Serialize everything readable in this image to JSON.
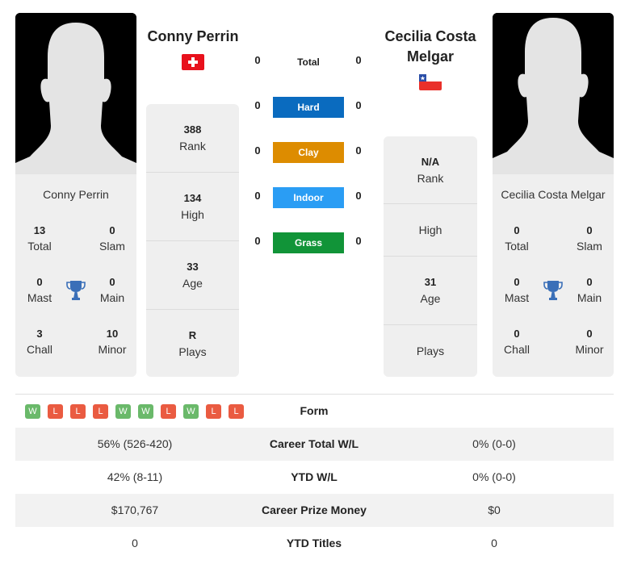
{
  "player1": {
    "name": "Conny Perrin",
    "flag": "switzerland-flag",
    "card_name": "Conny Perrin",
    "titles": {
      "total": {
        "value": "13",
        "label": "Total"
      },
      "slam": {
        "value": "0",
        "label": "Slam"
      },
      "mast": {
        "value": "0",
        "label": "Mast"
      },
      "main": {
        "value": "0",
        "label": "Main"
      },
      "chall": {
        "value": "3",
        "label": "Chall"
      },
      "minor": {
        "value": "10",
        "label": "Minor"
      }
    },
    "info": {
      "rank": {
        "value": "388",
        "label": "Rank"
      },
      "high": {
        "value": "134",
        "label": "High"
      },
      "age": {
        "value": "33",
        "label": "Age"
      },
      "plays": {
        "value": "R",
        "label": "Plays"
      }
    }
  },
  "player2": {
    "name": "Cecilia Costa Melgar",
    "flag": "chile-flag",
    "card_name": "Cecilia Costa Melgar",
    "titles": {
      "total": {
        "value": "0",
        "label": "Total"
      },
      "slam": {
        "value": "0",
        "label": "Slam"
      },
      "mast": {
        "value": "0",
        "label": "Mast"
      },
      "main": {
        "value": "0",
        "label": "Main"
      },
      "chall": {
        "value": "0",
        "label": "Chall"
      },
      "minor": {
        "value": "0",
        "label": "Minor"
      }
    },
    "info": {
      "rank": {
        "value": "N/A",
        "label": "Rank"
      },
      "high": {
        "value": "",
        "label": "High"
      },
      "age": {
        "value": "31",
        "label": "Age"
      },
      "plays": {
        "value": "",
        "label": "Plays"
      }
    }
  },
  "h2h": {
    "total": {
      "label": "Total",
      "p1": "0",
      "p2": "0"
    },
    "surfaces": [
      {
        "label": "Hard",
        "p1": "0",
        "p2": "0",
        "color": "#0a6bbf"
      },
      {
        "label": "Clay",
        "p1": "0",
        "p2": "0",
        "color": "#dd8c00"
      },
      {
        "label": "Indoor",
        "p1": "0",
        "p2": "0",
        "color": "#2a9df4"
      },
      {
        "label": "Grass",
        "p1": "0",
        "p2": "0",
        "color": "#119438"
      }
    ]
  },
  "form": {
    "label": "Form",
    "results": [
      "W",
      "L",
      "L",
      "L",
      "W",
      "W",
      "L",
      "W",
      "L",
      "L"
    ],
    "colors": {
      "W": "#6ab96a",
      "L": "#ea5b41"
    }
  },
  "stats": [
    {
      "label": "Career Total W/L",
      "p1": "56% (526-420)",
      "p2": "0% (0-0)"
    },
    {
      "label": "YTD W/L",
      "p1": "42% (8-11)",
      "p2": "0% (0-0)"
    },
    {
      "label": "Career Prize Money",
      "p1": "$170,767",
      "p2": "$0"
    },
    {
      "label": "YTD Titles",
      "p1": "0",
      "p2": "0"
    }
  ],
  "colors": {
    "trophy": "#3a6fb8",
    "card_bg": "#efefef"
  }
}
